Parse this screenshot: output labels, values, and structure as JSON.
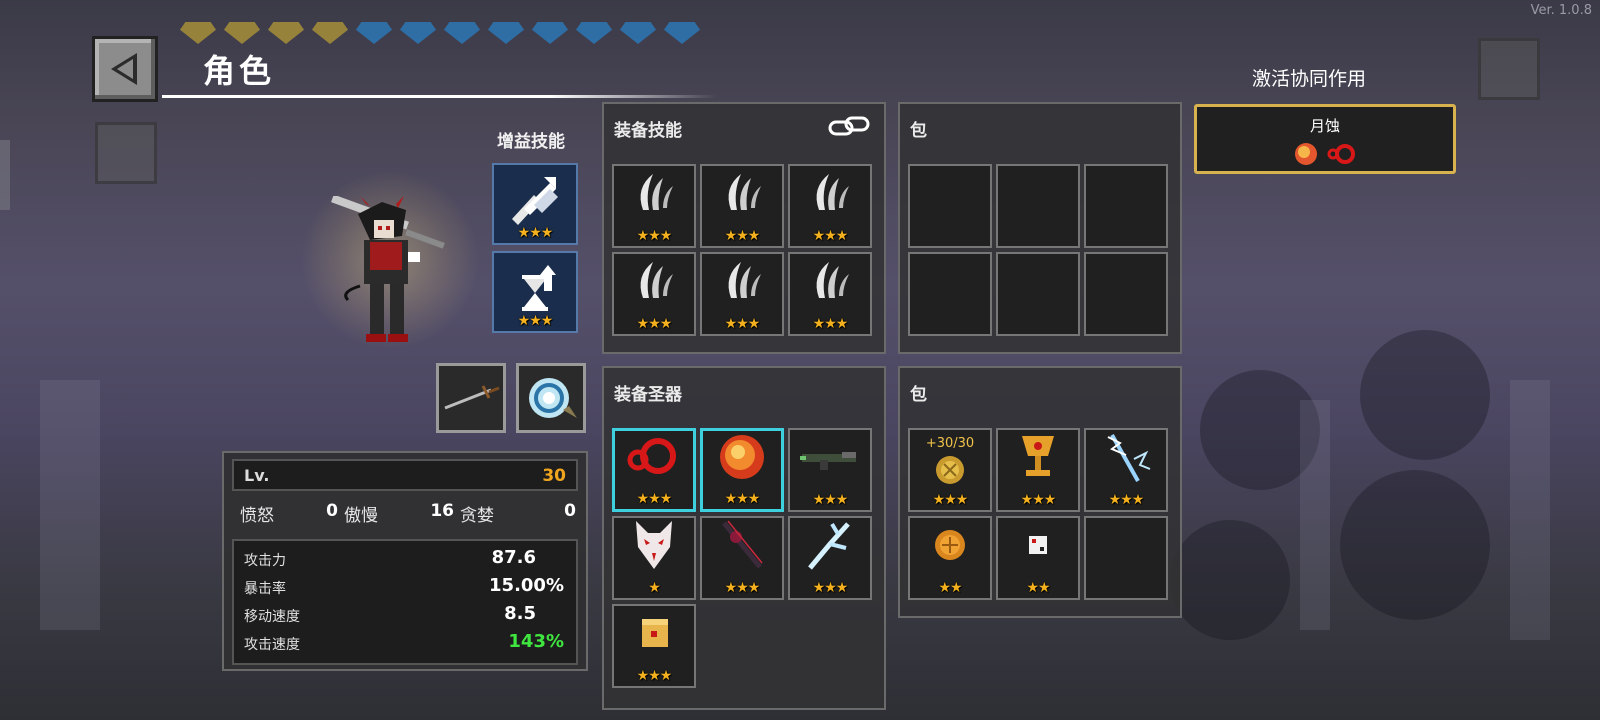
{
  "version": "Ver. 1.0.8",
  "header": {
    "title": "角色"
  },
  "pet_skills": {
    "label": "增益技能",
    "slots": [
      {
        "icon": "shield-arrow-up-icon",
        "stars": "★★★"
      },
      {
        "icon": "hourglass-arrow-up-icon",
        "stars": "★★★"
      }
    ]
  },
  "weapons": [
    {
      "icon": "sword-icon"
    },
    {
      "icon": "swirl-scroll-icon"
    }
  ],
  "equip_skills": {
    "title": "装备技能",
    "slots": [
      {
        "icon": "claw-slash-icon",
        "stars": "★★★"
      },
      {
        "icon": "claw-slash-icon",
        "stars": "★★★"
      },
      {
        "icon": "claw-slash-icon",
        "stars": "★★★"
      },
      {
        "icon": "claw-slash-icon",
        "stars": "★★★"
      },
      {
        "icon": "claw-slash-icon",
        "stars": "★★★"
      },
      {
        "icon": "claw-slash-icon",
        "stars": "★★★"
      }
    ]
  },
  "skill_bag": {
    "title": "包",
    "slots": [
      {},
      {},
      {},
      {},
      {},
      {}
    ]
  },
  "equip_relics": {
    "title": "装备圣器",
    "slots": [
      {
        "icon": "red-ring-icon",
        "stars": "★★★",
        "highlight": true
      },
      {
        "icon": "fire-orb-icon",
        "stars": "★★★",
        "highlight": true
      },
      {
        "icon": "rifle-icon",
        "stars": "★★★"
      },
      {
        "icon": "fox-mask-icon",
        "stars": "★"
      },
      {
        "icon": "dark-staff-icon",
        "stars": "★★★"
      },
      {
        "icon": "ice-branch-icon",
        "stars": "★★★"
      },
      {
        "icon": "dice-box-icon",
        "stars": "★★★"
      }
    ]
  },
  "relic_bag": {
    "title": "包",
    "slots": [
      {
        "icon": "gold-coin-icon",
        "stars": "★★★",
        "count": "+30/30"
      },
      {
        "icon": "golden-chalice-icon",
        "stars": "★★★"
      },
      {
        "icon": "lightning-staff-icon",
        "stars": "★★★"
      },
      {
        "icon": "bronze-coin-icon",
        "stars": "★★"
      },
      {
        "icon": "white-dice-icon",
        "stars": "★★"
      },
      {}
    ]
  },
  "synergy": {
    "label": "激活协同作用",
    "name": "月蚀"
  },
  "stats": {
    "level_label": "Lv.",
    "level_value": "30",
    "sins": [
      {
        "name": "愤怒",
        "value": "0"
      },
      {
        "name": "傲慢",
        "value": "16"
      },
      {
        "name": "贪婪",
        "value": "0"
      }
    ],
    "attributes": [
      {
        "name": "攻击力",
        "value": "87.6"
      },
      {
        "name": "暴击率",
        "value": "15.00%"
      },
      {
        "name": "移动速度",
        "value": "8.5"
      },
      {
        "name": "攻击速度",
        "value": "143%"
      }
    ]
  },
  "colors": {
    "star": "#f5b11d",
    "level": "#f0a51e",
    "highlight_green": "#3fe63f",
    "synergy_border": "#d7b24f",
    "slot_highlight": "#3fd0e0"
  }
}
